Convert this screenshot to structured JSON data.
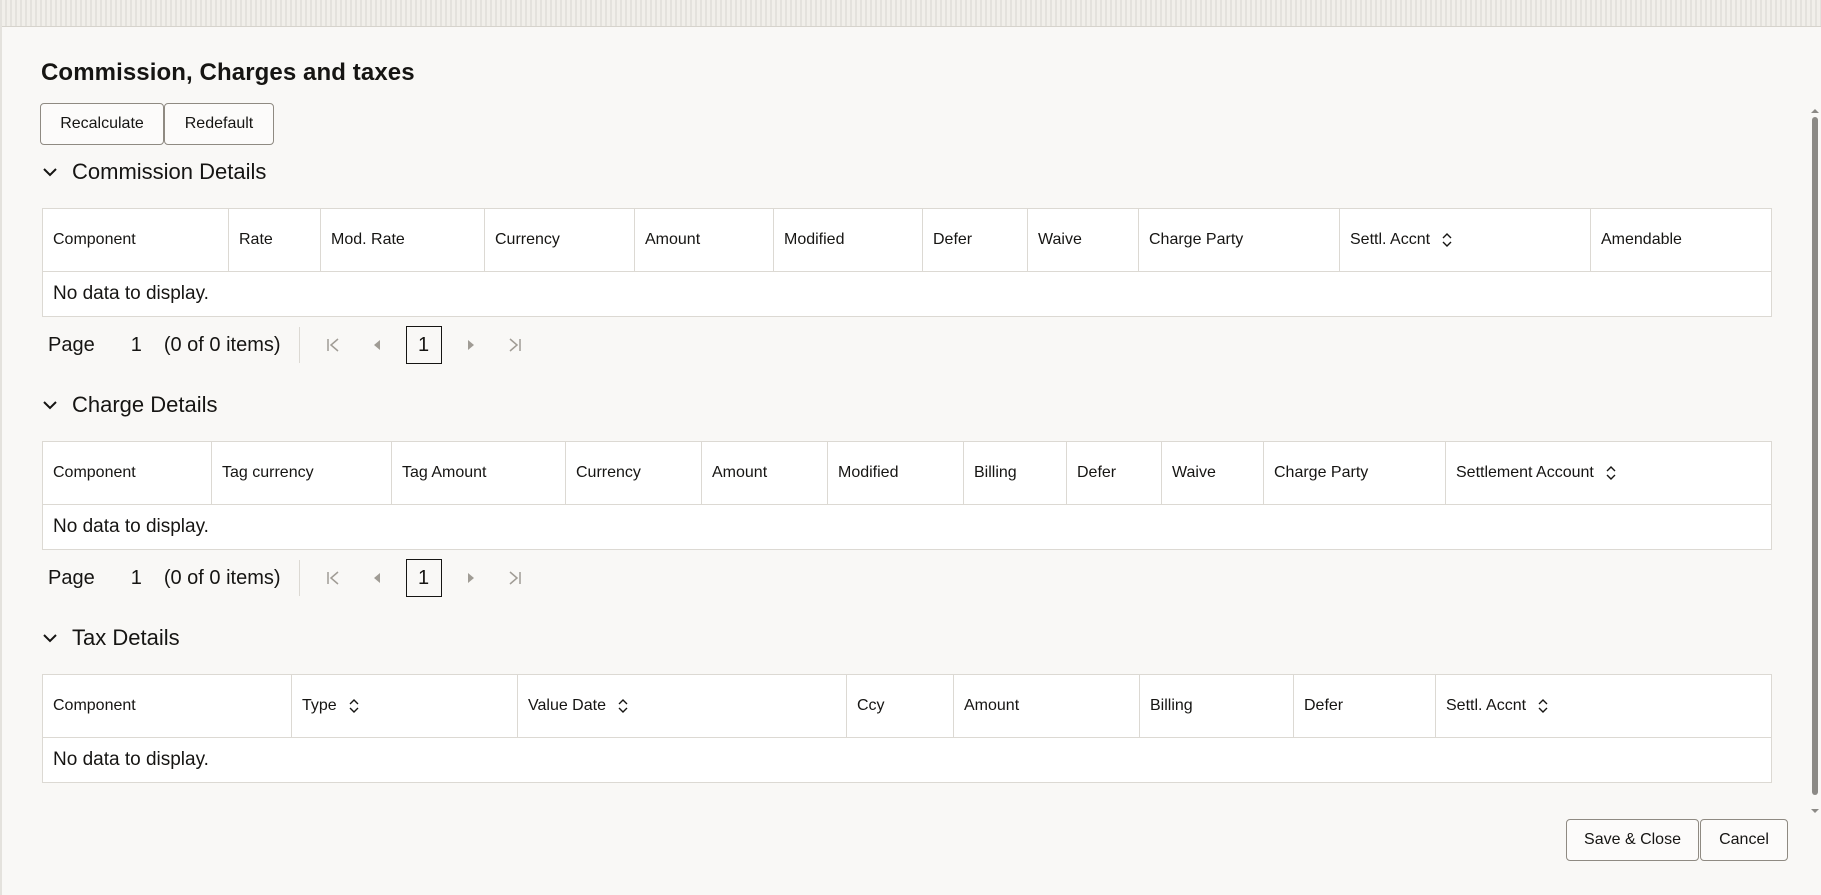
{
  "dialog": {
    "title": "Commission, Charges and taxes",
    "buttons": {
      "recalculate": "Recalculate",
      "redefault": "Redefault"
    },
    "footer": {
      "save_close": "Save & Close",
      "cancel": "Cancel"
    }
  },
  "commission": {
    "heading": "Commission Details",
    "columns": [
      "Component",
      "Rate",
      "Mod. Rate",
      "Currency",
      "Amount",
      "Modified",
      "Defer",
      "Waive",
      "Charge Party",
      "Settl. Accnt",
      "Amendable"
    ],
    "empty": "No data to display.",
    "pager": {
      "page_label": "Page",
      "page": "1",
      "items": "(0 of 0 items)",
      "current": "1"
    }
  },
  "charge": {
    "heading": "Charge Details",
    "columns": [
      "Component",
      "Tag currency",
      "Tag Amount",
      "Currency",
      "Amount",
      "Modified",
      "Billing",
      "Defer",
      "Waive",
      "Charge Party",
      "Settlement Account"
    ],
    "empty": "No data to display.",
    "pager": {
      "page_label": "Page",
      "page": "1",
      "items": "(0 of 0 items)",
      "current": "1"
    }
  },
  "tax": {
    "heading": "Tax Details",
    "columns": [
      "Component",
      "Type",
      "Value Date",
      "Ccy",
      "Amount",
      "Billing",
      "Defer",
      "Settl. Accnt"
    ],
    "empty": "No data to display."
  },
  "colors": {
    "border": "#dcd9d3",
    "text": "#161513",
    "background": "#f9f8f6"
  }
}
